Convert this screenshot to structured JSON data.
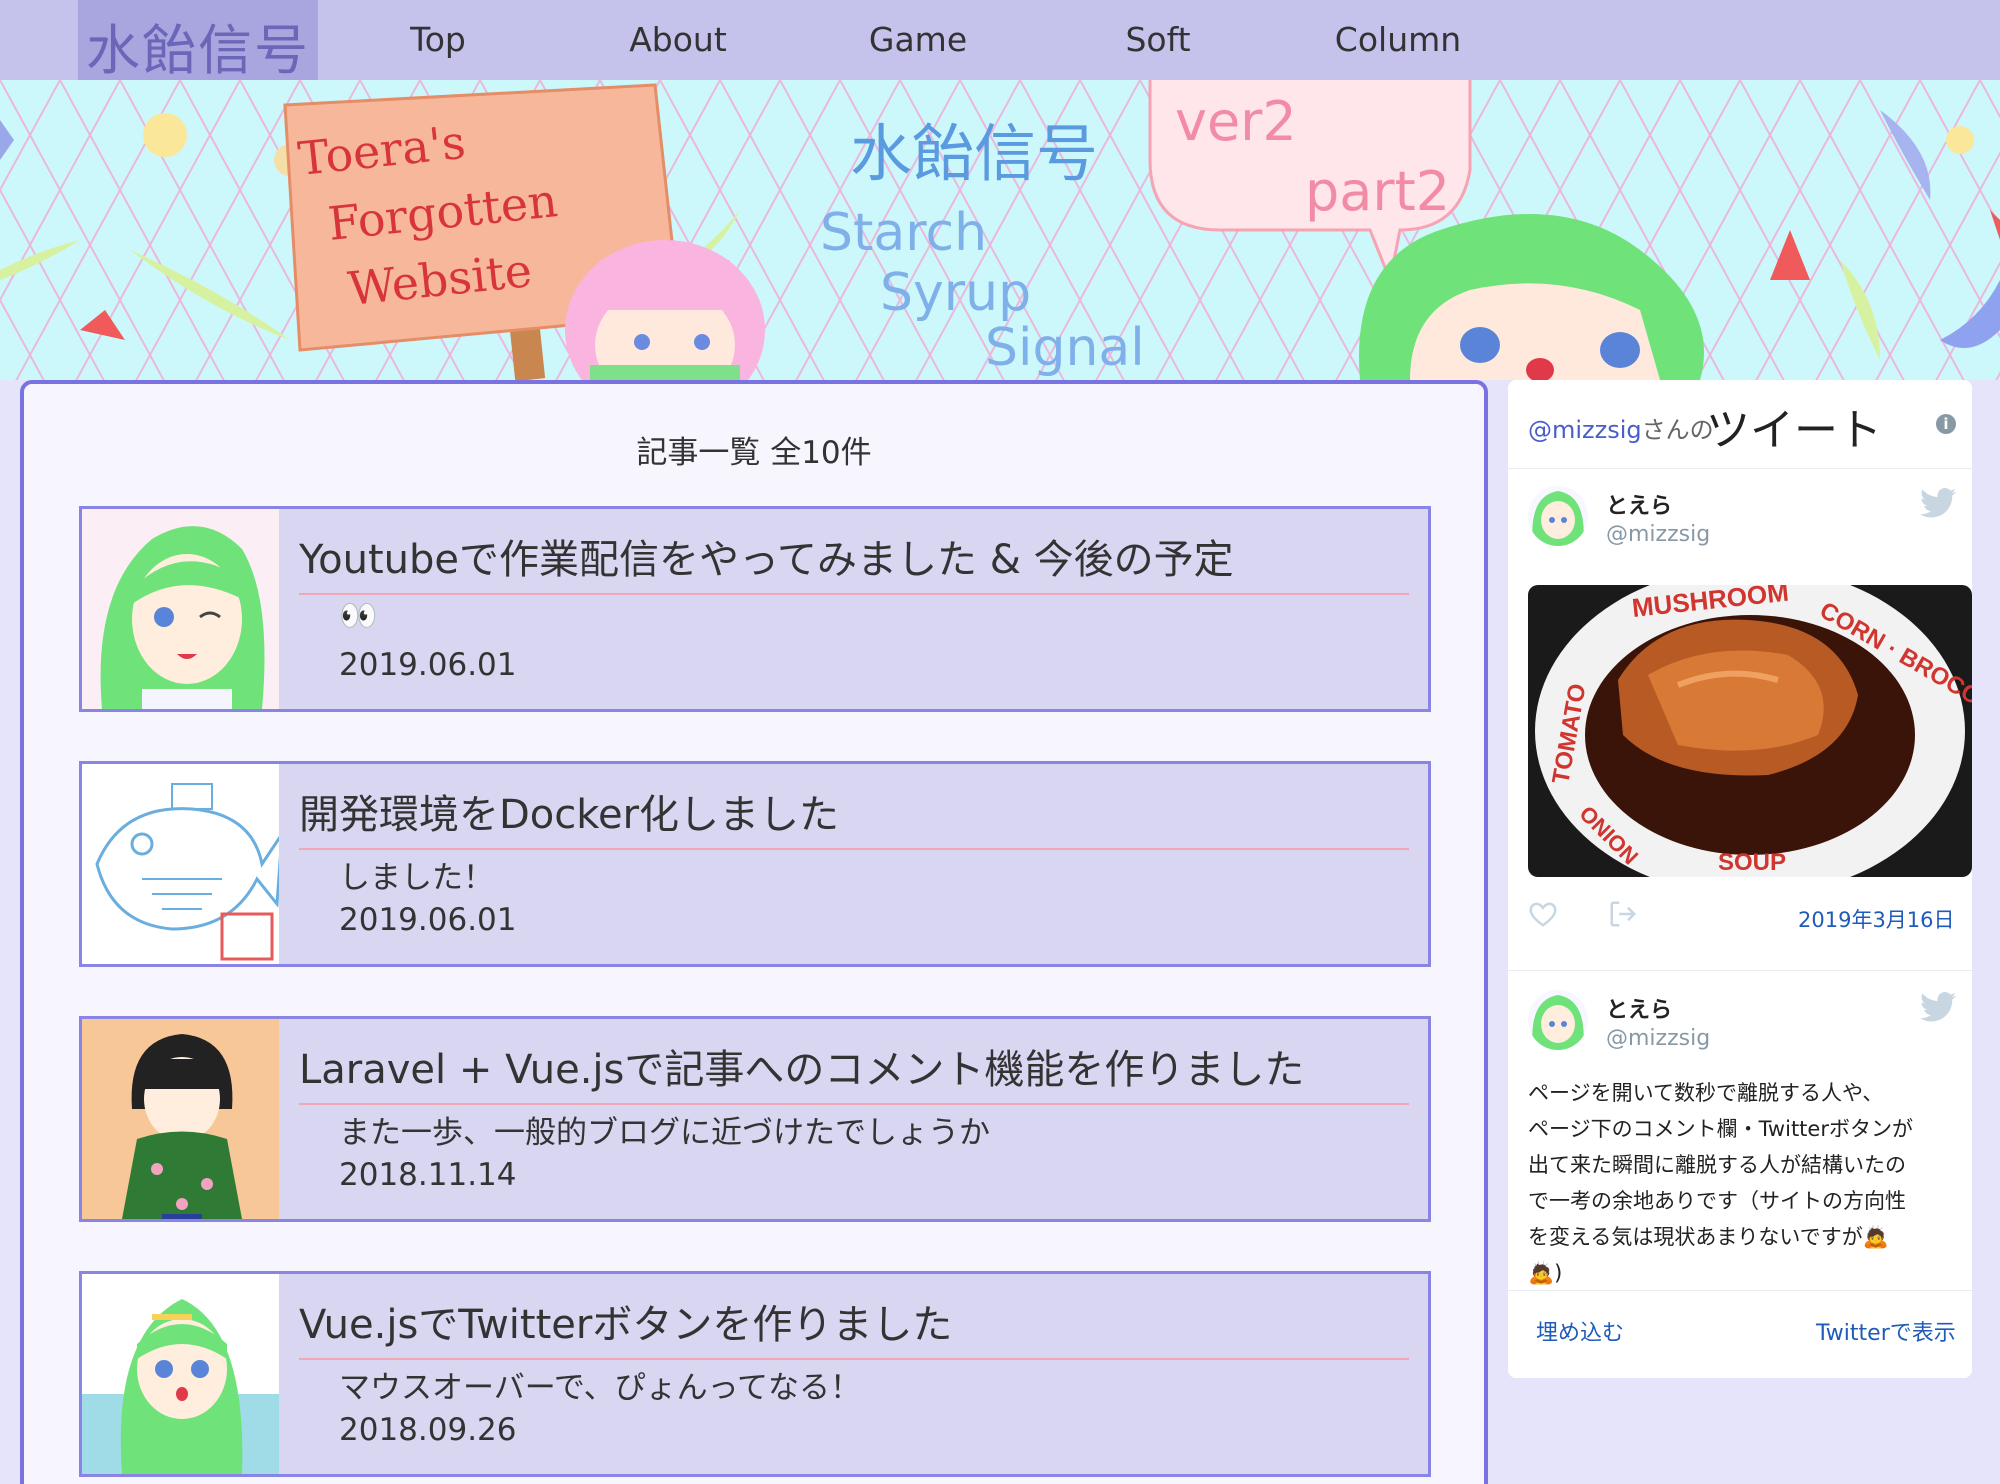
{
  "nav": {
    "logo": "水飴信号",
    "items": [
      {
        "label": "Top"
      },
      {
        "label": "About"
      },
      {
        "label": "Game"
      },
      {
        "label": "Soft"
      },
      {
        "label": "Column"
      }
    ]
  },
  "banner": {
    "sign_line1": "Toera's",
    "sign_line2": "Forgotten",
    "sign_line3": "Website",
    "title_jp": "水飴信号",
    "title_en1": "Starch",
    "title_en2": "Syrup",
    "title_en3": "Signal",
    "bubble_ver": "ver2",
    "bubble_part": "part2"
  },
  "articles": {
    "heading": "記事一覧 全10件",
    "items": [
      {
        "title": "Youtubeで作業配信をやってみました & 今後の予定",
        "desc": "👀",
        "date": "2019.06.01"
      },
      {
        "title": "開発環境をDocker化しました",
        "desc": "しました！",
        "date": "2019.06.01"
      },
      {
        "title": "Laravel + Vue.jsで記事へのコメント機能を作りました",
        "desc": "また一歩、一般的ブログに近づけたでしょうか",
        "date": "2018.11.14"
      },
      {
        "title": "Vue.jsでTwitterボタンを作りました",
        "desc": "マウスオーバーで、ぴょんってなる！",
        "date": "2018.09.26"
      }
    ]
  },
  "twitter": {
    "handle": "@mizzsig",
    "handle_suffix": "さんの",
    "heading": "ツイート",
    "tweets": [
      {
        "name": "とえら",
        "handle": "@mizzsig",
        "date": "2019年3月16日"
      },
      {
        "name": "とえら",
        "handle": "@mizzsig",
        "text_lines": [
          "ページを開いて数秒で離脱する人や、",
          "ページ下のコメント欄・Twitterボタンが",
          "出て来た瞬間に離脱する人が結構いたの",
          "で一考の余地ありです（サイトの方向性",
          "を変える気は現状あまりないですが🙇",
          "🙇)"
        ]
      }
    ],
    "plate_text": {
      "top": "MUSHROOM",
      "right": "CORN · BROCCOLI",
      "left": "TOMATO",
      "bottom_left": "ONION",
      "bottom": "SOUP"
    },
    "embed_label": "埋め込む",
    "view_label": "Twitterで表示"
  }
}
